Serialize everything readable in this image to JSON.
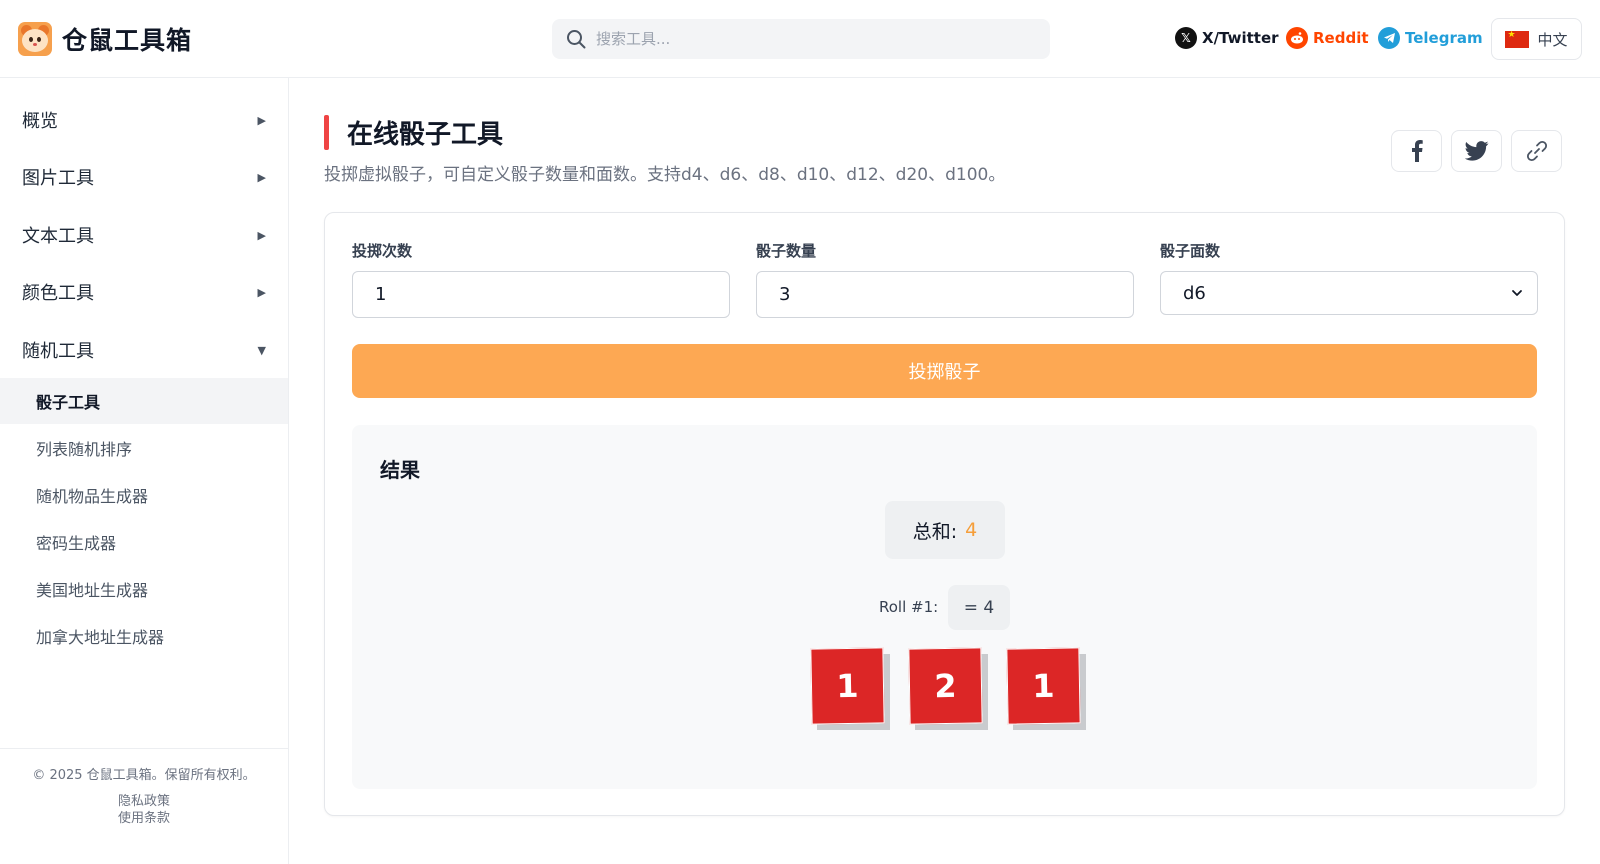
{
  "header": {
    "app_title": "仓鼠工具箱",
    "search_placeholder": "搜索工具...",
    "social": {
      "twitter": "X/Twitter",
      "reddit": "Reddit",
      "telegram": "Telegram"
    },
    "language": "中文"
  },
  "sidebar": {
    "categories": [
      {
        "label": "概览",
        "expanded": false
      },
      {
        "label": "图片工具",
        "expanded": false
      },
      {
        "label": "文本工具",
        "expanded": false
      },
      {
        "label": "颜色工具",
        "expanded": false
      },
      {
        "label": "随机工具",
        "expanded": true
      }
    ],
    "sub_items": [
      {
        "label": "骰子工具",
        "active": true
      },
      {
        "label": "列表随机排序",
        "active": false
      },
      {
        "label": "随机物品生成器",
        "active": false
      },
      {
        "label": "密码生成器",
        "active": false
      },
      {
        "label": "美国地址生成器",
        "active": false
      },
      {
        "label": "加拿大地址生成器",
        "active": false
      }
    ],
    "footer": {
      "copyright": "© 2025 仓鼠工具箱。保留所有权利。",
      "privacy": "隐私政策",
      "terms": "使用条款"
    }
  },
  "main": {
    "title": "在线骰子工具",
    "description": "投掷虚拟骰子，可自定义骰子数量和面数。支持d4、d6、d8、d10、d12、d20、d100。",
    "form": {
      "rolls_label": "投掷次数",
      "rolls_value": "1",
      "count_label": "骰子数量",
      "count_value": "3",
      "sides_label": "骰子面数",
      "sides_value": "d6"
    },
    "roll_button": "投掷骰子",
    "result": {
      "title": "结果",
      "sum_label": "总和:",
      "sum_value": "4",
      "roll_label": "Roll #1:",
      "roll_total": "= 4",
      "dice": [
        "1",
        "2",
        "1"
      ]
    }
  },
  "colors": {
    "accent": "#fda853",
    "die": "#dc2626",
    "title_bar": "#ef4444",
    "sum_value": "#f59e3a"
  }
}
